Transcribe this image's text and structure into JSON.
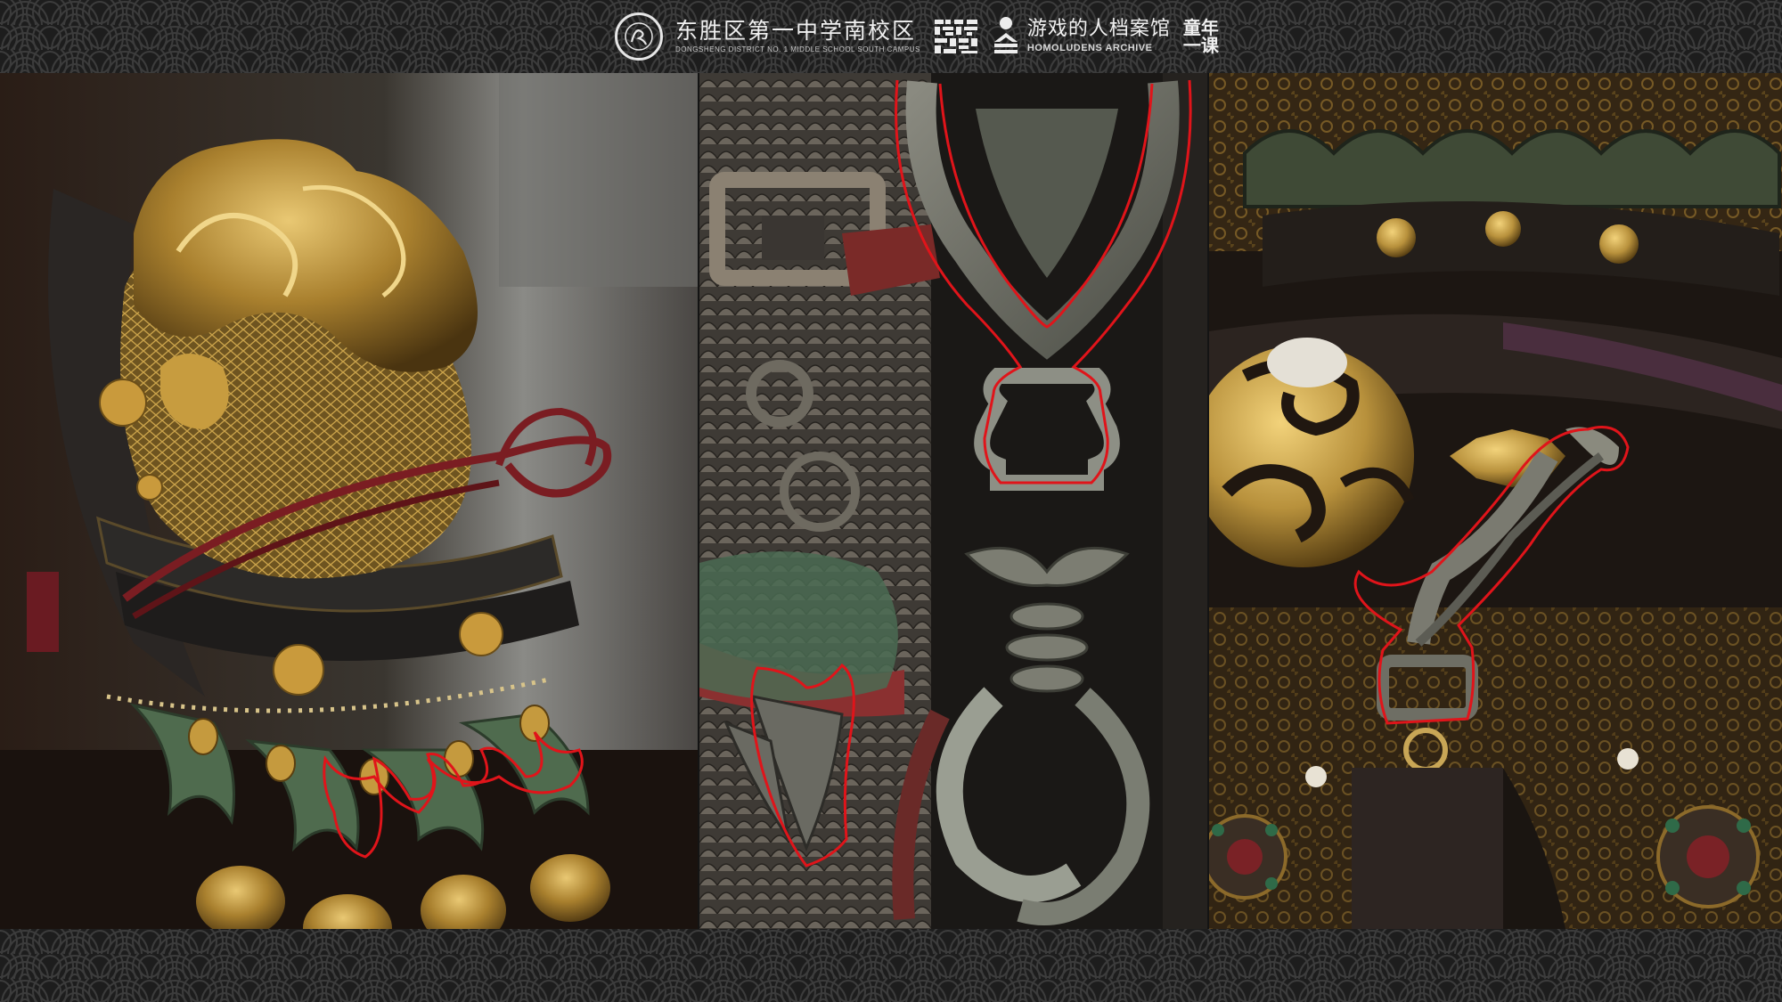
{
  "header": {
    "school_name_cn": "东胜区第一中学南校区",
    "school_name_en": "DONGSHENG DISTRICT NO. 1 MIDDLE SCHOOL SOUTH CAMPUS",
    "archive_name_cn": "游戏的人档案馆",
    "archive_name_en": "HOMOLUDENS ARCHIVE",
    "childhood_line1": "童年",
    "childhood_line2": "一课"
  },
  "colors": {
    "background": "#141414",
    "wave_stroke": "#3c3c3c",
    "highlight_outline": "#e0141a",
    "gold": "#b8913c",
    "jade": "#4f6b4e",
    "crimson": "#7a1d22"
  },
  "icons": [
    "school-seal-icon",
    "pixel-block-logo-icon",
    "archive-figure-icon"
  ],
  "panels": [
    {
      "subject": "game-armor-closeup"
    },
    {
      "subject": "temple-sculpture-closeup"
    },
    {
      "subject": "game-belt-ornament-closeup"
    }
  ]
}
